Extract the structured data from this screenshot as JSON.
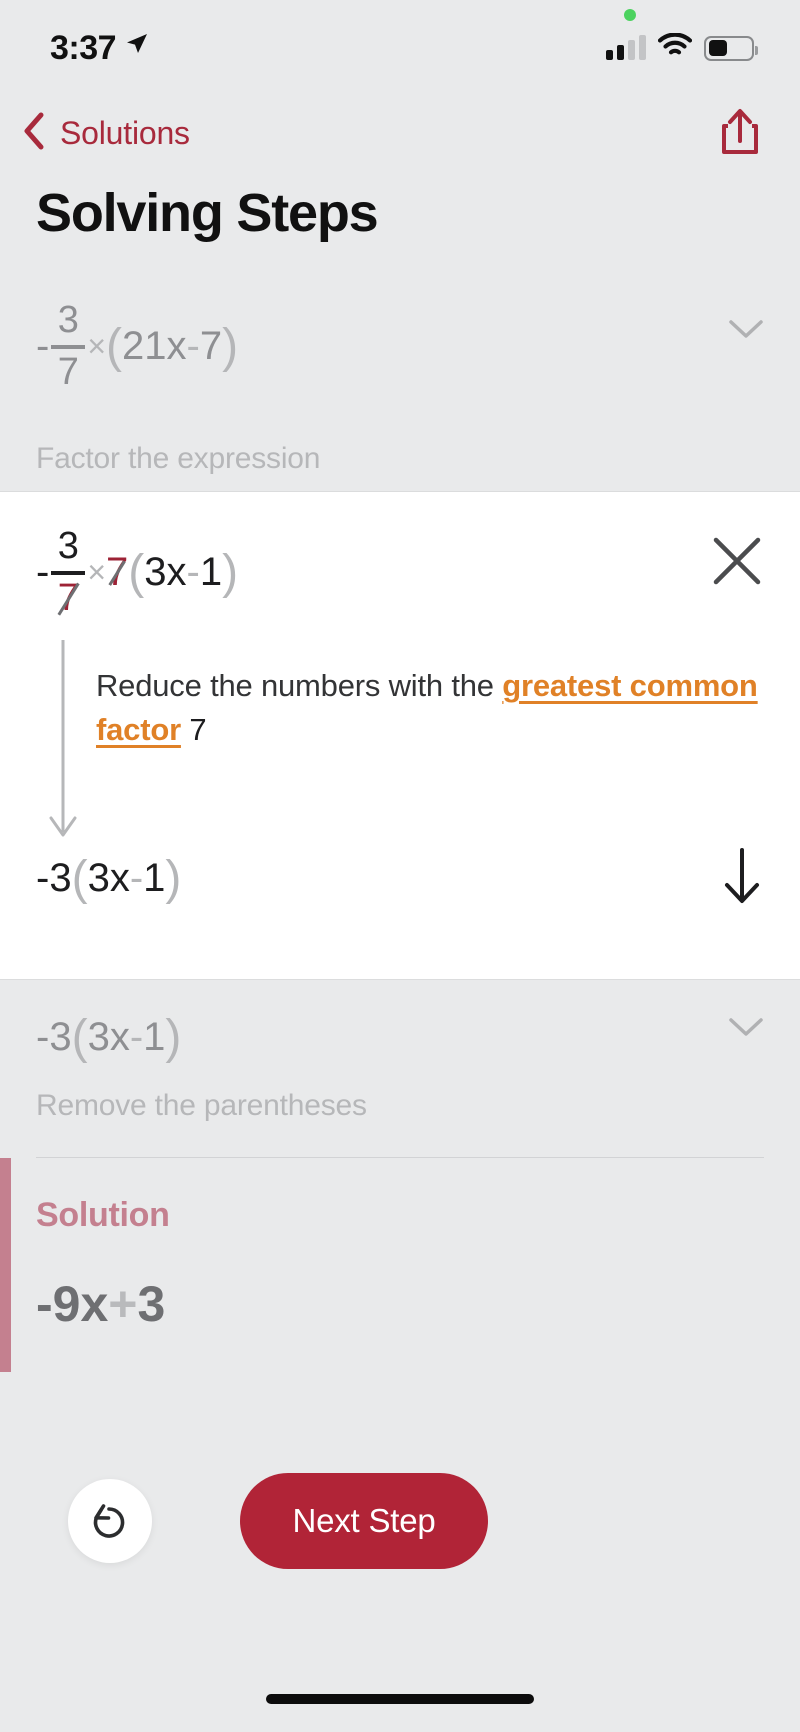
{
  "status_bar": {
    "time": "3:37",
    "location_icon": "location-arrow-icon",
    "privacy_indicator": "green-privacy-dot",
    "signal_icon": "cellular-signal-icon",
    "wifi_icon": "wifi-icon",
    "battery_icon": "battery-icon",
    "battery_level_percent": 46
  },
  "nav": {
    "back_icon": "chevron-left-icon",
    "back_label": "Solutions",
    "share_icon": "share-icon",
    "accent_color": "#a82a3c"
  },
  "header": {
    "title": "Solving Steps"
  },
  "steps": [
    {
      "id": "step-factor",
      "state": "collapsed",
      "expression_parts": {
        "sign": "-",
        "fraction_numerator": "3",
        "fraction_denominator": "7",
        "times": "×",
        "open_paren": "(",
        "coefficient": "21",
        "variable": "x",
        "operator": "-",
        "constant": "7",
        "close_paren": ")"
      },
      "description": "Factor the expression",
      "chevron_icon": "chevron-down-icon"
    },
    {
      "id": "step-remove-parentheses",
      "state": "collapsed",
      "expression_parts": {
        "sign": "-",
        "coefficient": "3",
        "open_paren": "(",
        "inner_coefficient": "3",
        "variable": "x",
        "operator": "-",
        "constant": "1",
        "close_paren": ")"
      },
      "description": "Remove the parentheses",
      "chevron_icon": "chevron-down-icon"
    }
  ],
  "active_card": {
    "close_icon": "close-x-icon",
    "top_expression": {
      "sign": "-",
      "fraction_numerator": "3",
      "fraction_denominator_struck": "7",
      "times": "×",
      "struck_factor": "7",
      "open_paren": "(",
      "inner_coefficient": "3",
      "variable": "x",
      "operator": "-",
      "constant": "1",
      "close_paren": ")"
    },
    "explanation": {
      "lead": "Reduce the numbers with the",
      "link": "greatest common factor",
      "tail": "7",
      "link_color": "#e08127"
    },
    "flow_arrow_icon": "long-down-arrow-icon",
    "bottom_expression": {
      "sign": "-",
      "coefficient": "3",
      "open_paren": "(",
      "inner_coefficient": "3",
      "variable": "x",
      "operator": "-",
      "constant": "1",
      "close_paren": ")"
    },
    "advance_icon": "arrow-down-icon"
  },
  "solution": {
    "label": "Solution",
    "accent_color": "#c4808f",
    "expression": {
      "sign": "-",
      "coefficient": "9",
      "variable": "x",
      "operator": "+",
      "constant": "3"
    }
  },
  "footer": {
    "undo_icon": "undo-arrow-icon",
    "next_label": "Next Step",
    "next_color": "#b12437"
  }
}
